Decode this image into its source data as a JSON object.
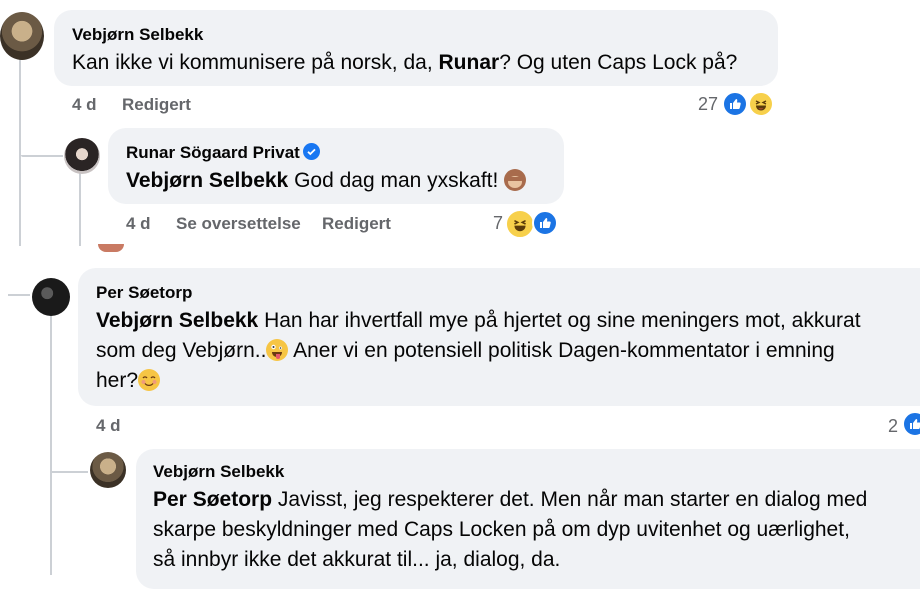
{
  "comments": [
    {
      "author": "Vebjørn Selbekk",
      "text_mention": "",
      "text_before": "Kan ikke vi kommunisere på norsk, da, ",
      "text_bold": "Runar",
      "text_after": "? Og uten Caps Lock på?",
      "time": "4 d",
      "action1": "Redigert",
      "reactions_count": "27"
    },
    {
      "author": "Runar Sögaard Privat",
      "verified": true,
      "mention": "Vebjørn Selbekk",
      "text": " God dag man yxskaft! ",
      "time": "4 d",
      "action1": "Se oversettelse",
      "action2": "Redigert",
      "reactions_count": "7"
    },
    {
      "author": "Per Søetorp",
      "mention": "Vebjørn Selbekk",
      "line1": " Han har ihvertfall mye på hjertet og sine meningers mot, akkurat",
      "line2": "som deg Vebjørn..",
      "line2b": " Aner vi en potensiell politisk Dagen-kommentator i emning",
      "line3": "her?",
      "time": "4 d",
      "reactions_count": "2"
    },
    {
      "author": "Vebjørn Selbekk",
      "mention": "Per Søetorp",
      "line1": " Javisst, jeg respekterer det. Men når man starter en dialog med",
      "line2": "skarpe beskyldninger med Caps Locken på om dyp uvitenhet og uærlighet,",
      "line3": "så innbyr ikke det akkurat til... ja, dialog, da."
    }
  ],
  "colors": {
    "bubble": "#f0f2f5",
    "meta": "#65676b",
    "like": "#1b74e4",
    "haha": "#f7d04b",
    "thread_line": "#ccd0d5"
  },
  "icons": [
    "like-reaction-icon",
    "haha-reaction-icon",
    "verified-badge-icon",
    "see-no-evil-monkey-emoji",
    "zany-face-emoji",
    "smiling-face-emoji"
  ]
}
